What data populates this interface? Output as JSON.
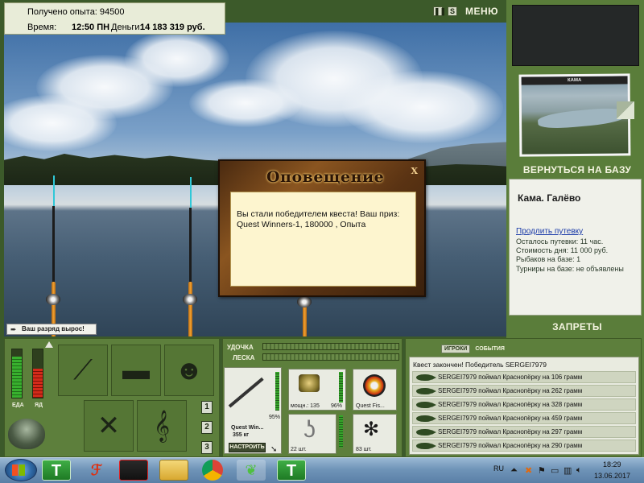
{
  "info": {
    "experience_label": "Получено опыта: 94500",
    "time_label": "Время:",
    "time_value": "12:50 ПН",
    "money_label": "Деньги:",
    "money_value": "14 183 319 руб."
  },
  "topbar": {
    "pause_icon": "pause-icon",
    "s_label": "S",
    "menu_label": "МЕНЮ"
  },
  "toast": {
    "text": "Ваш разряд вырос!"
  },
  "dialog": {
    "title": "Оповещение",
    "close": "X",
    "message": "Вы стали победителем квеста! Ваш приз: Quest Winners-1, 180000 , Опыта"
  },
  "right": {
    "photo_caption": "КАМА",
    "back_label": "ВЕРНУТЬСЯ НА БАЗУ",
    "base_name": "Кама. Галёво",
    "extend_link": "Продлить путевку",
    "stats": [
      "Осталось путевки: 11 час.",
      "Стоимость дня: 11 000 руб.",
      "Рыбаков на базе: 1",
      "Турниры на базе: не объявлены"
    ],
    "bans_label": "ЗАПРЕТЫ"
  },
  "gauges": {
    "food_label": "ЕДА",
    "poison_label": "ЯД",
    "food_level": 0.85,
    "poison_level": 0.6
  },
  "numbers": [
    "1",
    "2",
    "3"
  ],
  "tackle": {
    "rod_label": "УДОЧКА",
    "line_label": "ЛЕСКА",
    "rod_percent": "95%",
    "rod_name": "Quest Win...",
    "rod_weight": "355 кг",
    "setup_label": "НАСТРОИТЬ",
    "reel_power": "мощн.: 135",
    "reel_percent": "96%",
    "line_name": "Quest Fis...",
    "hooks_count": "22 шт.",
    "bait_count": "83 шт."
  },
  "log": {
    "tab_players": "ИГРОКИ",
    "tab_events": "СОБЫТИЯ",
    "header": "Квест закончен! Победитель SERGEI7979",
    "rows": [
      "SERGEI7979 поймал Краснопёрку на 106 грамм",
      "SERGEI7979 поймал Краснопёрку на 262 грамм",
      "SERGEI7979 поймал Краснопёрку на 328 грамм",
      "SERGEI7979 поймал Краснопёрку на 459 грамм",
      "SERGEI7979 поймал Краснопёрку на 297 грамм",
      "SERGEI7979 поймал Краснопёрку на 290 грамм"
    ]
  },
  "taskbar": {
    "app_t1": "T",
    "app_t2": "T",
    "lang": "RU",
    "time": "18:29",
    "date": "13.06.2017"
  }
}
